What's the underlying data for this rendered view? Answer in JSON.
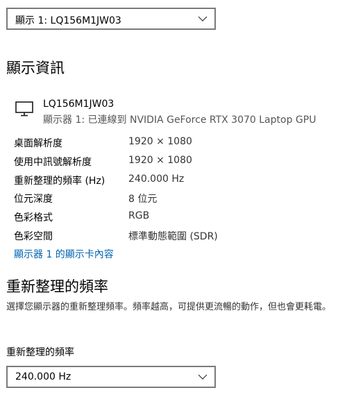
{
  "display_select": {
    "value": "顯示 1: LQ156M1JW03"
  },
  "display_info": {
    "heading": "顯示資訊",
    "monitor_name": "LQ156M1JW03",
    "monitor_desc": "顯示器 1: 已連線到 NVIDIA GeForce RTX 3070 Laptop GPU",
    "rows": [
      {
        "label": "桌面解析度",
        "value": "1920 × 1080"
      },
      {
        "label": "使用中訊號解析度",
        "value": "1920 × 1080"
      },
      {
        "label": "重新整理的頻率 (Hz)",
        "value": "240.000 Hz"
      },
      {
        "label": "位元深度",
        "value": "8 位元"
      },
      {
        "label": "色彩格式",
        "value": "RGB"
      },
      {
        "label": "色彩空間",
        "value": "標準動態範圍 (SDR)"
      }
    ],
    "adapter_link": "顯示器 1 的顯示卡內容"
  },
  "refresh": {
    "heading": "重新整理的頻率",
    "description": "選擇您顯示器的重新整理頻率。頻率越高，可提供更流暢的動作，但也會更耗電。",
    "field_label": "重新整理的頻率",
    "select_value": "240.000 Hz"
  },
  "icons": {
    "monitor": "monitor-icon",
    "dropdown": "chevron-down-icon"
  },
  "colors": {
    "link": "#0063b1",
    "border": "#7a7a7a"
  }
}
